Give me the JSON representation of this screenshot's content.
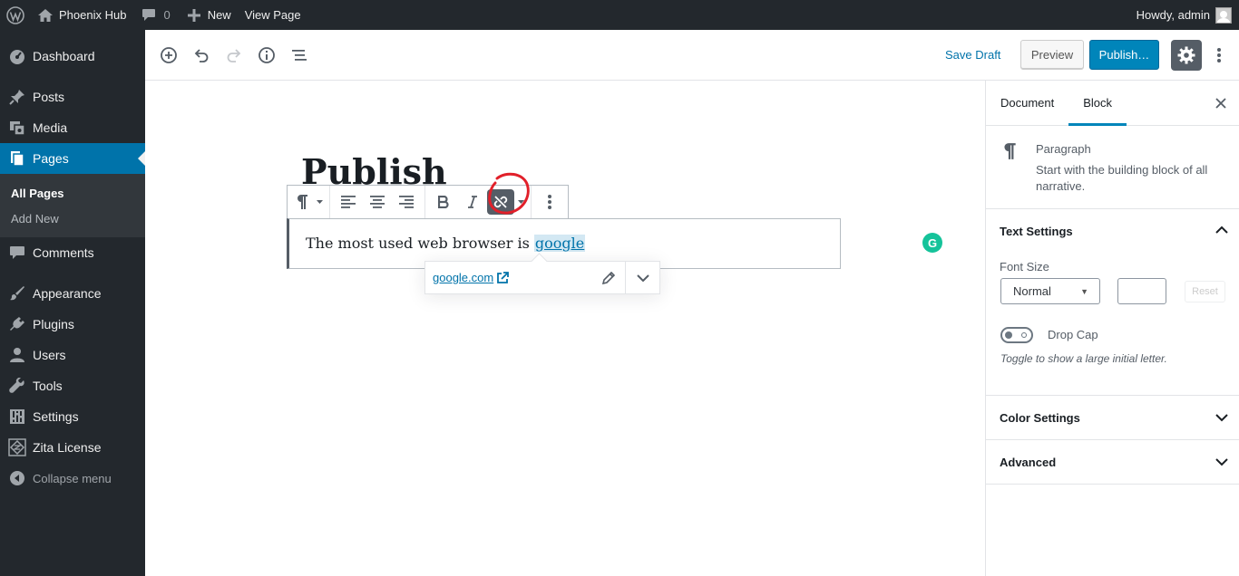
{
  "adminbar": {
    "site_name": "Phoenix Hub",
    "comments_count": "0",
    "new_label": "New",
    "view_page": "View Page",
    "howdy": "Howdy, admin"
  },
  "sidebar": {
    "items": [
      {
        "label": "Dashboard",
        "icon": "dashboard-icon"
      },
      {
        "label": "Posts",
        "icon": "pin-icon"
      },
      {
        "label": "Media",
        "icon": "media-icon"
      },
      {
        "label": "Pages",
        "icon": "pages-icon"
      },
      {
        "label": "Comments",
        "icon": "comment-icon"
      },
      {
        "label": "Appearance",
        "icon": "brush-icon"
      },
      {
        "label": "Plugins",
        "icon": "plugin-icon"
      },
      {
        "label": "Users",
        "icon": "user-icon"
      },
      {
        "label": "Tools",
        "icon": "wrench-icon"
      },
      {
        "label": "Settings",
        "icon": "settings-icon"
      },
      {
        "label": "Zita License",
        "icon": "zita-icon"
      }
    ],
    "submenu": [
      "All Pages",
      "Add New"
    ],
    "collapse": "Collapse menu"
  },
  "header": {
    "save_draft": "Save Draft",
    "preview": "Preview",
    "publish": "Publish…"
  },
  "editor": {
    "title": "Publish",
    "paragraph_prefix": "The most used web browser is ",
    "link_text": "google",
    "link_url": "google.com",
    "grammarly": "G"
  },
  "settings": {
    "tab_document": "Document",
    "tab_block": "Block",
    "block_name": "Paragraph",
    "block_desc": "Start with the building block of all narrative.",
    "text_settings": "Text Settings",
    "font_size_label": "Font Size",
    "font_size_value": "Normal",
    "reset": "Reset",
    "drop_cap": "Drop Cap",
    "drop_cap_help": "Toggle to show a large initial letter.",
    "color_settings": "Color Settings",
    "advanced": "Advanced"
  },
  "colors": {
    "accent": "#0073aa",
    "publish_button": "#0085ba",
    "adminbar_bg": "#23282d",
    "annotation_red": "#e1202a"
  }
}
